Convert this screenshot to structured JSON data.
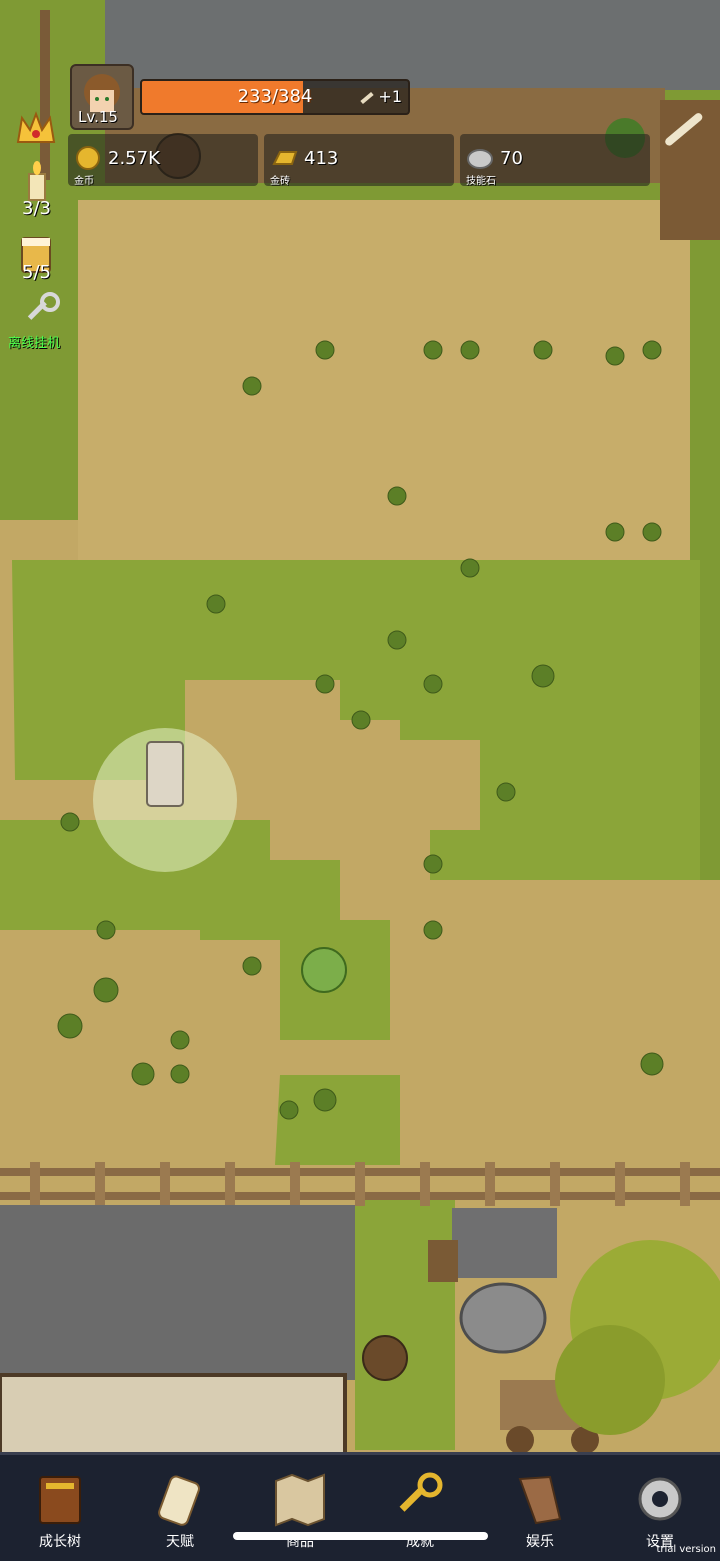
{
  "player": {
    "level": "Lv.15"
  },
  "xp": {
    "current": 233,
    "max": 384,
    "label": "233/384",
    "gain": "+1"
  },
  "resources": [
    {
      "name": "gold",
      "value": "2.57K",
      "label": "金币"
    },
    {
      "name": "gold-brick",
      "value": "413",
      "label": "金砖"
    },
    {
      "name": "skill-stone",
      "value": "70",
      "label": "技能石"
    }
  ],
  "side": {
    "candle_count": "3/3",
    "drink_count": "5/5",
    "idle_label": "离线挂机"
  },
  "nav": [
    {
      "label": "成长树",
      "icon": "book-icon"
    },
    {
      "label": "天赋",
      "icon": "scroll-icon"
    },
    {
      "label": "商品",
      "icon": "map-icon"
    },
    {
      "label": "成就",
      "icon": "key-icon"
    },
    {
      "label": "娱乐",
      "icon": "cloth-icon"
    },
    {
      "label": "设置",
      "icon": "gear-icon"
    }
  ],
  "footer": {
    "trial": "trial version"
  },
  "colors": {
    "dirt": "#c2a865",
    "grass": "#8fa83a",
    "xp": "#f07a2c",
    "nav": "#1c2230"
  }
}
